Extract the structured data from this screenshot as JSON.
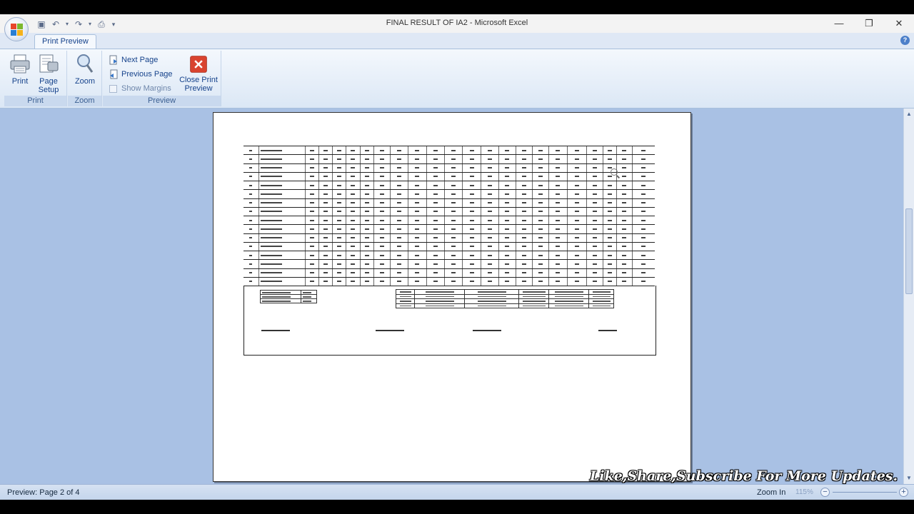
{
  "window": {
    "title": "FINAL RESULT  OF IA2 - Microsoft Excel",
    "controls": [
      "minimize",
      "restore",
      "close"
    ]
  },
  "ribbon": {
    "tab": "Print Preview",
    "groups": {
      "print": {
        "label": "Print",
        "print_btn": "Print",
        "page_setup_btn": "Page Setup"
      },
      "zoom": {
        "label": "Zoom",
        "zoom_btn": "Zoom"
      },
      "preview": {
        "label": "Preview",
        "next_page": "Next Page",
        "previous_page": "Previous Page",
        "show_margins": "Show Margins",
        "close_preview": "Close Print Preview"
      }
    }
  },
  "status": {
    "preview_text": "Preview: Page 2 of 4",
    "zoom_label": "Zoom In",
    "zoom_pct": "115%"
  },
  "watermark": "Like,Share,Subscribe For More Updates."
}
